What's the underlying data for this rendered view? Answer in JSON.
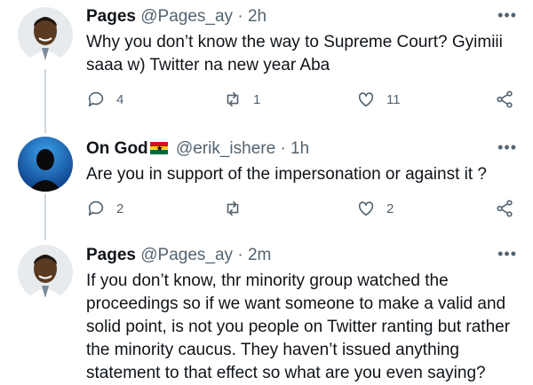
{
  "tweets": [
    {
      "name": "Pages",
      "handle": "@Pages_ay",
      "separator": "·",
      "time": "2h",
      "text": "Why you don’t know the way to Supreme Court? Gyimiii saaa w) Twitter na new year Aba",
      "replies": "4",
      "retweets": "1",
      "likes": "11",
      "more": "•••"
    },
    {
      "name": "On God",
      "handle": "@erik_ishere",
      "separator": "·",
      "time": "1h",
      "text": "Are you in support of the impersonation or against it ?",
      "replies": "2",
      "retweets": "",
      "likes": "2",
      "more": "•••"
    },
    {
      "name": "Pages",
      "handle": "@Pages_ay",
      "separator": "·",
      "time": "2m",
      "text": "If you don’t know, thr minority group watched the proceedings so if we want someone to make a valid and solid point, is not you people on Twitter ranting but rather the minority caucus. They haven’t issued anything statement to that effect so what are you even saying?",
      "more": "•••"
    }
  ],
  "colors": {
    "text": "#0f1419",
    "secondary": "#536471",
    "thread_line": "#cfd9de"
  },
  "icons": [
    "reply-icon",
    "retweet-icon",
    "like-icon",
    "share-icon",
    "more-icon",
    "ghana-flag-icon"
  ]
}
